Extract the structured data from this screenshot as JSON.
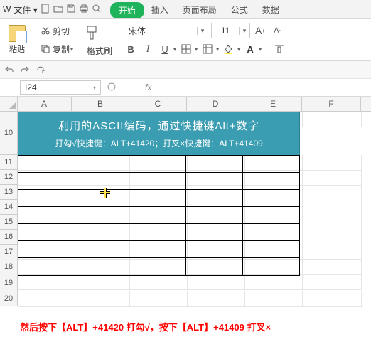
{
  "menu": {
    "file": "文件",
    "tabs": [
      "开始",
      "插入",
      "页面布局",
      "公式",
      "数据"
    ]
  },
  "ribbon": {
    "paste": "粘贴",
    "cut": "剪切",
    "copy": "复制",
    "formatPainter": "格式刷",
    "fontName": "宋体",
    "fontSize": "11"
  },
  "namebox": {
    "ref": "I24",
    "fx": "fx"
  },
  "columns": [
    "A",
    "B",
    "C",
    "D",
    "E",
    "F"
  ],
  "rows": [
    "10",
    "11",
    "12",
    "13",
    "14",
    "15",
    "16",
    "17",
    "18",
    "19",
    "20"
  ],
  "banner": {
    "title": "利用的ASCII编码，通过快捷键Alt+数字",
    "sub": "打勾√快捷键：ALT+41420；打叉×快捷键：ALT+41409"
  },
  "instruction": "然后按下【ALT】+41420 打勾√，按下【ALT】+41409 打叉×"
}
